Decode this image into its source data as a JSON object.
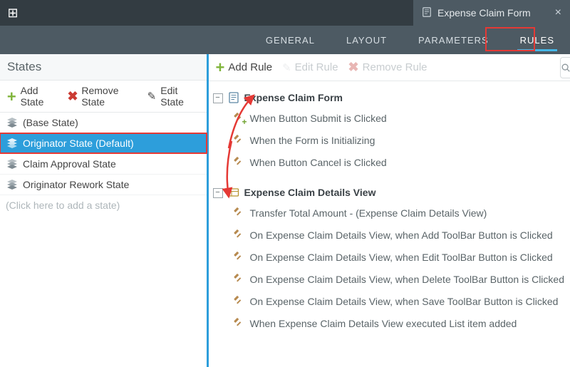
{
  "topbar": {
    "doc_tab_title": "Expense Claim Form",
    "close_glyph": "×"
  },
  "subnav": {
    "items": [
      "GENERAL",
      "LAYOUT",
      "PARAMETERS",
      "RULES"
    ],
    "active_index": 3
  },
  "states": {
    "title": "States",
    "toolbar": {
      "add": "Add State",
      "remove": "Remove State",
      "edit": "Edit State"
    },
    "items": [
      {
        "label": "(Base State)",
        "selected": false
      },
      {
        "label": "Originator State (Default)",
        "selected": true
      },
      {
        "label": "Claim Approval State",
        "selected": false
      },
      {
        "label": "Originator Rework State",
        "selected": false
      }
    ],
    "add_placeholder": "(Click here to add a state)"
  },
  "rules_toolbar": {
    "add": "Add Rule",
    "edit": "Edit Rule",
    "remove": "Remove Rule"
  },
  "rules_tree": {
    "groups": [
      {
        "header": "Expense Claim Form",
        "icon": "form",
        "children": [
          {
            "icon": "gavel-plus",
            "label": "When Button Submit is Clicked"
          },
          {
            "icon": "gavel",
            "label": "When the Form is Initializing"
          },
          {
            "icon": "gavel",
            "label": "When Button Cancel is Clicked"
          }
        ]
      },
      {
        "header": "Expense Claim Details View",
        "icon": "view",
        "children": [
          {
            "icon": "gavel",
            "label": "Transfer Total Amount - (Expense Claim Details View)"
          },
          {
            "icon": "gavel",
            "label": "On Expense Claim Details View, when Add ToolBar Button is Clicked"
          },
          {
            "icon": "gavel",
            "label": "On Expense Claim Details View, when Edit ToolBar Button is Clicked"
          },
          {
            "icon": "gavel",
            "label": "On Expense Claim Details View, when Delete ToolBar Button is Clicked"
          },
          {
            "icon": "gavel",
            "label": "On Expense Claim Details View, when Save ToolBar Button is Clicked"
          },
          {
            "icon": "gavel",
            "label": "When Expense Claim Details View executed List item added"
          }
        ]
      }
    ]
  }
}
